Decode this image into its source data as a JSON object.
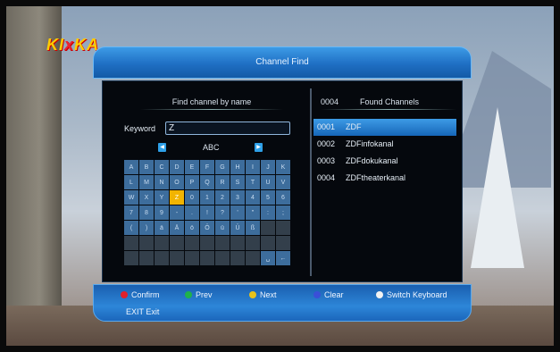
{
  "background": {
    "logo_left": "KI",
    "logo_x": "x",
    "logo_right": "KA"
  },
  "dialog": {
    "title": "Channel Find"
  },
  "left_panel": {
    "header": "Find channel by name",
    "keyword_label": "Keyword",
    "keyword_value": "Z",
    "mode_label": "ABC",
    "keyboard_rows": [
      [
        "A",
        "B",
        "C",
        "D",
        "E",
        "F",
        "G",
        "H",
        "I",
        "J",
        "K"
      ],
      [
        "L",
        "M",
        "N",
        "O",
        "P",
        "Q",
        "R",
        "S",
        "T",
        "U",
        "V"
      ],
      [
        "W",
        "X",
        "Y",
        "Z",
        "0",
        "1",
        "2",
        "3",
        "4",
        "5",
        "6"
      ],
      [
        "7",
        "8",
        "9",
        "-",
        ".",
        "!",
        "?",
        "'",
        "\"",
        ":",
        ";"
      ],
      [
        "(",
        ")",
        "ä",
        "Ä",
        "ö",
        "Ö",
        "ü",
        "Ü",
        "ß",
        "",
        ""
      ],
      [
        "",
        "",
        "",
        "",
        "",
        "",
        "",
        "",
        "",
        "",
        ""
      ],
      [
        "",
        "",
        "",
        "",
        "",
        "",
        "",
        "",
        "",
        "␣",
        "←"
      ]
    ],
    "selected_key": "Z"
  },
  "right_panel": {
    "count": "0004",
    "header": "Found Channels",
    "channels": [
      {
        "num": "0001",
        "name": "ZDF",
        "selected": true
      },
      {
        "num": "0002",
        "name": "ZDFinfokanal",
        "selected": false
      },
      {
        "num": "0003",
        "name": "ZDFdokukanal",
        "selected": false
      },
      {
        "num": "0004",
        "name": "ZDFtheaterkanal",
        "selected": false
      }
    ]
  },
  "footer": {
    "buttons": [
      {
        "label": "Confirm",
        "color": "#e0202a",
        "icon": "red-button-icon"
      },
      {
        "label": "Prev",
        "color": "#1fb24a",
        "icon": "green-button-icon"
      },
      {
        "label": "Next",
        "color": "#e8c21a",
        "icon": "yellow-button-icon"
      },
      {
        "label": "Clear",
        "color": "#3a4fd8",
        "icon": "blue-button-icon"
      },
      {
        "label": "Switch Keyboard",
        "color": "#f2f2f2",
        "icon": "white-button-icon"
      }
    ],
    "exit_label": "EXIT Exit"
  },
  "colors": {
    "accent": "#2d86d8",
    "selected_key": "#f2b400",
    "key": "#3d6d9c"
  }
}
